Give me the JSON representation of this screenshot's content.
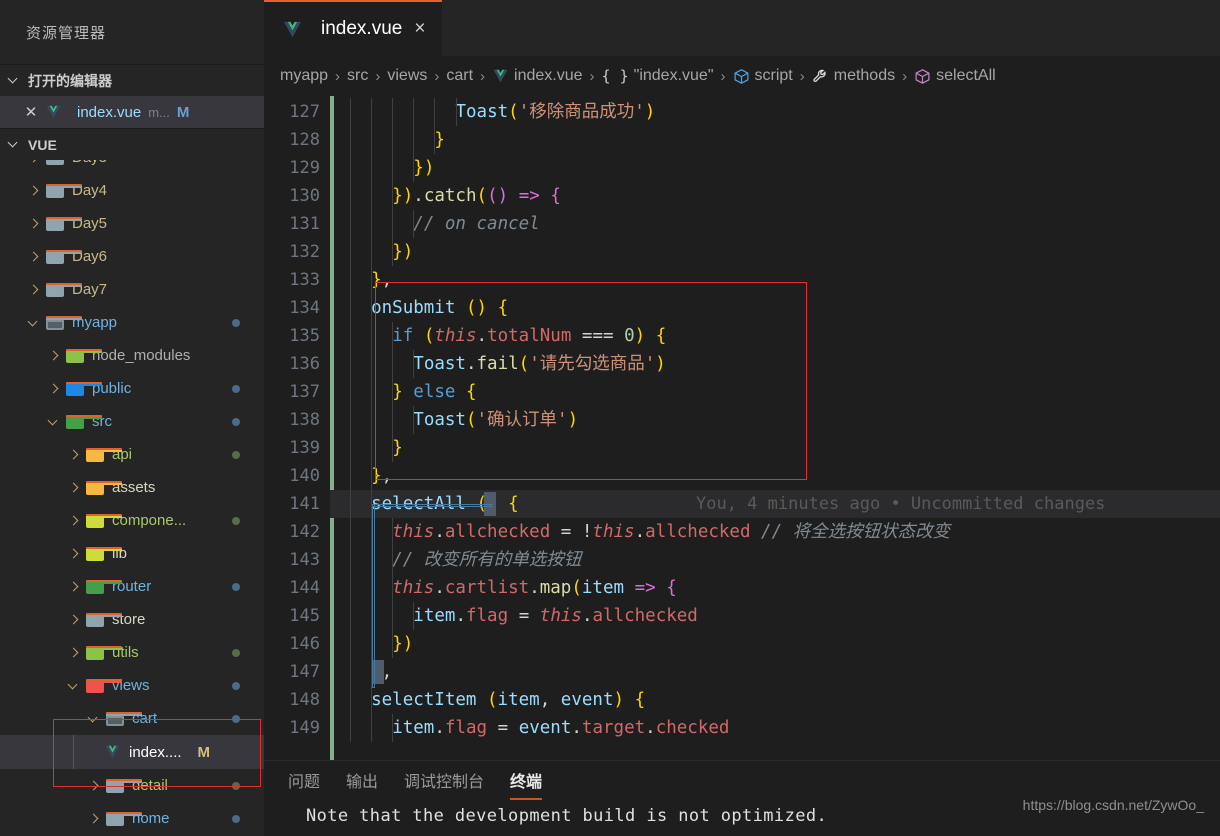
{
  "sidebar": {
    "title": "资源管理器",
    "sections": [
      {
        "label": "打开的编辑器",
        "expanded": true
      },
      {
        "label": "VUE",
        "expanded": true
      }
    ],
    "open_editors": [
      {
        "close_icon": "close-icon",
        "file_icon": "vue-icon",
        "name": "index.vue",
        "dim": "m...",
        "badge": "M"
      }
    ],
    "tree": [
      {
        "label": "Day4",
        "icon": "folder-icon",
        "twisty": "chevron-right-icon",
        "indent": 26,
        "color": "#c9b88a",
        "icon_color": "#90a4ae",
        "dot": ""
      },
      {
        "label": "Day5",
        "icon": "folder-icon",
        "twisty": "chevron-right-icon",
        "indent": 26,
        "color": "#c9b88a",
        "icon_color": "#90a4ae",
        "dot": ""
      },
      {
        "label": "Day6",
        "icon": "folder-icon",
        "twisty": "chevron-right-icon",
        "indent": 26,
        "color": "#c9b88a",
        "icon_color": "#90a4ae",
        "dot": ""
      },
      {
        "label": "Day7",
        "icon": "folder-icon",
        "twisty": "chevron-right-icon",
        "indent": 26,
        "color": "#c9b88a",
        "icon_color": "#90a4ae",
        "dot": ""
      },
      {
        "label": "myapp",
        "icon": "folder-open-icon",
        "twisty": "chevron-down-icon",
        "indent": 26,
        "color": "#6fb3e0",
        "icon_color": "#90a4ae",
        "dot": "#4a6b8a"
      },
      {
        "label": "node_modules",
        "icon": "folder-node-icon",
        "twisty": "chevron-right-icon",
        "indent": 46,
        "color": "#b0b0b0",
        "icon_color": "#8bc34a",
        "dot": ""
      },
      {
        "label": "public",
        "icon": "folder-public-icon",
        "twisty": "chevron-right-icon",
        "indent": 46,
        "color": "#6fb3e0",
        "icon_color": "#1e88e5",
        "dot": "#4a6b8a"
      },
      {
        "label": "src",
        "icon": "folder-src-icon",
        "twisty": "chevron-down-icon",
        "indent": 46,
        "color": "#6fb3e0",
        "icon_color": "#43a047",
        "dot": "#4a6b8a"
      },
      {
        "label": "api",
        "icon": "folder-api-icon",
        "twisty": "chevron-right-icon",
        "indent": 66,
        "color": "#a8c86a",
        "icon_color": "#f5b942",
        "dot": "#5a6b48"
      },
      {
        "label": "assets",
        "icon": "folder-assets-icon",
        "twisty": "chevron-right-icon",
        "indent": 66,
        "color": "#d8d8c0",
        "icon_color": "#f5b942",
        "dot": ""
      },
      {
        "label": "compone...",
        "icon": "folder-components-icon",
        "twisty": "chevron-right-icon",
        "indent": 66,
        "color": "#a8c86a",
        "icon_color": "#cddc39",
        "dot": "#5a6b48"
      },
      {
        "label": "lib",
        "icon": "folder-lib-icon",
        "twisty": "chevron-right-icon",
        "indent": 66,
        "color": "#d8d8c0",
        "icon_color": "#cddc39",
        "dot": ""
      },
      {
        "label": "router",
        "icon": "folder-router-icon",
        "twisty": "chevron-right-icon",
        "indent": 66,
        "color": "#6fb3e0",
        "icon_color": "#43a047",
        "dot": "#4a6b8a"
      },
      {
        "label": "store",
        "icon": "folder-icon",
        "twisty": "chevron-right-icon",
        "indent": 66,
        "color": "#d8d8c0",
        "icon_color": "#90a4ae",
        "dot": ""
      },
      {
        "label": "utils",
        "icon": "folder-utils-icon",
        "twisty": "chevron-right-icon",
        "indent": 66,
        "color": "#a8c86a",
        "icon_color": "#8bc34a",
        "dot": "#5a6b48"
      },
      {
        "label": "views",
        "icon": "folder-views-icon",
        "twisty": "chevron-down-icon",
        "indent": 66,
        "color": "#6fb3e0",
        "icon_color": "#ef5350",
        "dot": "#4a6b8a"
      },
      {
        "label": "cart",
        "icon": "folder-open-icon",
        "twisty": "chevron-down-icon",
        "indent": 86,
        "color": "#6fb3e0",
        "icon_color": "#90a4ae",
        "dot": "#4a6b8a"
      },
      {
        "label": "detail",
        "icon": "folder-icon",
        "twisty": "chevron-right-icon",
        "indent": 86,
        "color": "#a8c86a",
        "icon_color": "#90a4ae",
        "dot": "#5a6b48"
      },
      {
        "label": "home",
        "icon": "folder-icon",
        "twisty": "chevron-right-icon",
        "indent": 86,
        "color": "#6fb3e0",
        "icon_color": "#90a4ae",
        "dot": "#4a6b8a"
      }
    ],
    "selected_file": {
      "name": "index....",
      "badge": "M",
      "icon": "vue-icon"
    }
  },
  "tabs": [
    {
      "label": "index.vue",
      "icon": "vue-icon",
      "close": "×",
      "active": true
    }
  ],
  "breadcrumb": [
    {
      "label": "myapp",
      "icon": ""
    },
    {
      "label": "src",
      "icon": ""
    },
    {
      "label": "views",
      "icon": ""
    },
    {
      "label": "cart",
      "icon": ""
    },
    {
      "label": "index.vue",
      "icon": "vue-icon"
    },
    {
      "label": "\"index.vue\"",
      "icon": "braces-icon"
    },
    {
      "label": "script",
      "icon": "cube-blue-icon"
    },
    {
      "label": "methods",
      "icon": "wrench-icon"
    },
    {
      "label": "selectAll",
      "icon": "cube-purple-icon"
    }
  ],
  "editor": {
    "first_line": 127,
    "lines": [
      {
        "n": 127,
        "indent_guides": [
          0,
          1,
          2,
          3,
          4,
          5
        ]
      },
      {
        "n": 128,
        "indent_guides": [
          0,
          1,
          2,
          3,
          4
        ]
      },
      {
        "n": 129,
        "indent_guides": [
          0,
          1,
          2,
          3
        ]
      },
      {
        "n": 130,
        "indent_guides": [
          0,
          1,
          2
        ]
      },
      {
        "n": 131,
        "indent_guides": [
          0,
          1,
          2,
          3
        ]
      },
      {
        "n": 132,
        "indent_guides": [
          0,
          1,
          2
        ]
      },
      {
        "n": 133,
        "indent_guides": [
          0,
          1
        ]
      },
      {
        "n": 134,
        "indent_guides": [
          0,
          1
        ]
      },
      {
        "n": 135,
        "indent_guides": [
          0,
          1,
          2
        ]
      },
      {
        "n": 136,
        "indent_guides": [
          0,
          1,
          2,
          3
        ]
      },
      {
        "n": 137,
        "indent_guides": [
          0,
          1,
          2
        ]
      },
      {
        "n": 138,
        "indent_guides": [
          0,
          1,
          2,
          3
        ]
      },
      {
        "n": 139,
        "indent_guides": [
          0,
          1,
          2
        ]
      },
      {
        "n": 140,
        "indent_guides": [
          0,
          1
        ]
      },
      {
        "n": 141,
        "indent_guides": [
          0,
          1
        ]
      },
      {
        "n": 142,
        "indent_guides": [
          0,
          1,
          2
        ]
      },
      {
        "n": 143,
        "indent_guides": [
          0,
          1,
          2
        ]
      },
      {
        "n": 144,
        "indent_guides": [
          0,
          1,
          2
        ]
      },
      {
        "n": 145,
        "indent_guides": [
          0,
          1,
          2,
          3
        ]
      },
      {
        "n": 146,
        "indent_guides": [
          0,
          1,
          2
        ]
      },
      {
        "n": 147,
        "indent_guides": [
          0,
          1
        ]
      },
      {
        "n": 148,
        "indent_guides": [
          0,
          1
        ]
      },
      {
        "n": 149,
        "indent_guides": [
          0,
          1,
          2
        ]
      }
    ],
    "code_text": [
      "          Toast('移除商品成功')",
      "        }",
      "      })",
      "    }).catch(() => {",
      "      // on cancel",
      "    })",
      "  },",
      "  onSubmit () {",
      "    if (this.totalNum === 0) {",
      "      Toast.fail('请先勾选商品')",
      "    } else {",
      "      Toast('确认订单')",
      "    }",
      "  },",
      "  selectAll () {",
      "    this.allchecked = !this.allchecked // 将全选按钮状态改变",
      "    // 改变所有的单选按钮",
      "    this.cartlist.map(item => {",
      "      item.flag = this.allchecked",
      "    })",
      "  },",
      "  selectItem (item, event) {",
      "    item.flag = event.target.checked"
    ],
    "blame_annotation": "You, 4 minutes ago • Uncommitted changes",
    "blame_line": 141,
    "current_line": 141
  },
  "panel": {
    "tabs": [
      {
        "label": "问题",
        "active": false
      },
      {
        "label": "输出",
        "active": false
      },
      {
        "label": "调试控制台",
        "active": false
      },
      {
        "label": "终端",
        "active": true
      }
    ],
    "terminal_line": "Note that the development build is not optimized."
  },
  "watermark": "https://blog.csdn.net/ZywOo_",
  "colors": {
    "accent": "#e0622f",
    "editor_bg": "#1e1e1e",
    "sidebar_bg": "#252526",
    "highlight_box": "#e03030",
    "git_modified": "#86b08a"
  }
}
